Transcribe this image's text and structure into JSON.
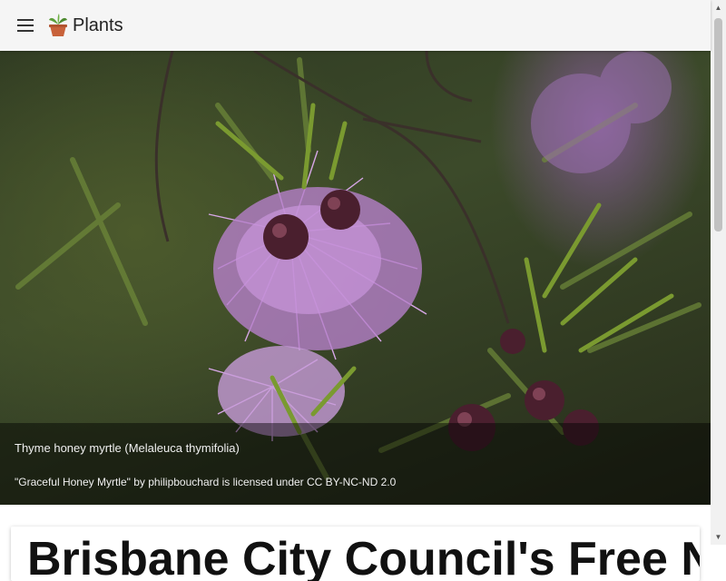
{
  "app": {
    "title": "Plants"
  },
  "hero": {
    "caption_title": "Thyme honey myrtle (Melaleuca thymifolia)",
    "caption_credit": "\"Graceful Honey Myrtle\" by philipbouchard is licensed under CC BY-NC-ND 2.0"
  },
  "card": {
    "heading": "Brisbane City Council's Free Native P"
  },
  "icons": {
    "menu": "menu-icon",
    "logo": "potted-plant-icon"
  }
}
